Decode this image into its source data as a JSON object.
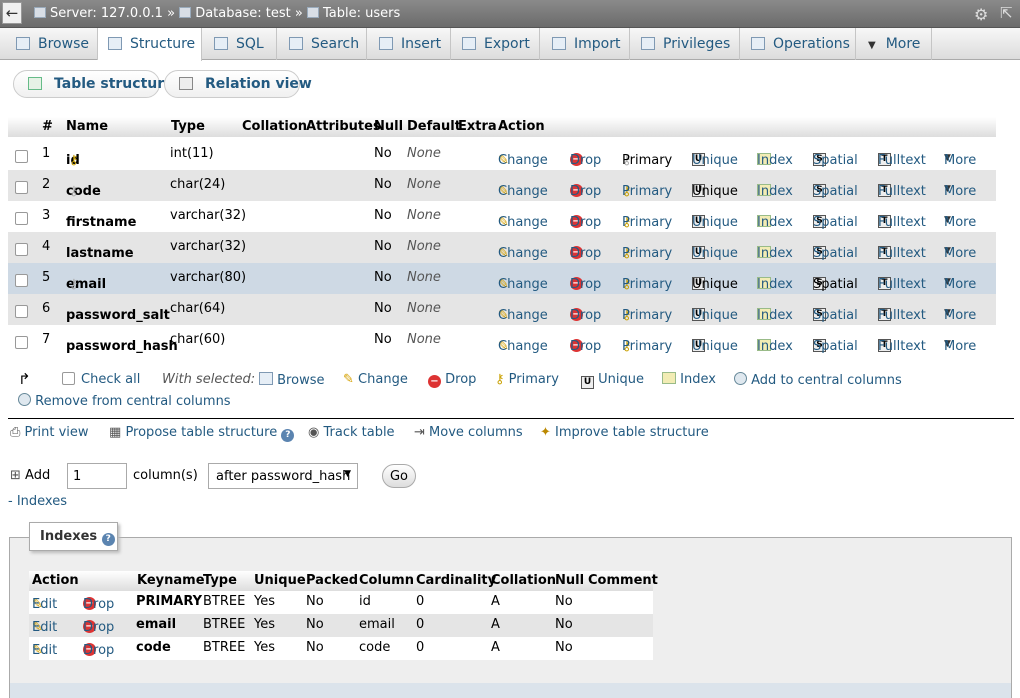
{
  "topbar": {
    "back": "←",
    "server": "Server: 127.0.0.1",
    "database": "Database: test",
    "table": "Table: users",
    "sep": "»"
  },
  "tabs": [
    {
      "label": "Browse",
      "icon": "browse-icon"
    },
    {
      "label": "Structure",
      "icon": "structure-icon",
      "active": true
    },
    {
      "label": "SQL",
      "icon": "sql-icon"
    },
    {
      "label": "Search",
      "icon": "search-icon"
    },
    {
      "label": "Insert",
      "icon": "insert-icon"
    },
    {
      "label": "Export",
      "icon": "export-icon"
    },
    {
      "label": "Import",
      "icon": "import-icon"
    },
    {
      "label": "Privileges",
      "icon": "privileges-icon"
    },
    {
      "label": "Operations",
      "icon": "wrench-icon"
    },
    {
      "label": "More",
      "icon": "chevron-down-icon"
    }
  ],
  "subtabs": {
    "table_structure": "Table structure",
    "relation_view": "Relation view"
  },
  "structure": {
    "headers": [
      "#",
      "Name",
      "Type",
      "Collation",
      "Attributes",
      "Null",
      "Default",
      "Extra",
      "Action"
    ],
    "rows": [
      {
        "num": "1",
        "name": "id",
        "type": "int(11)",
        "null": "No",
        "default": "None",
        "key": "primary"
      },
      {
        "num": "2",
        "name": "code",
        "type": "char(24)",
        "null": "No",
        "default": "None",
        "key": "unique"
      },
      {
        "num": "3",
        "name": "firstname",
        "type": "varchar(32)",
        "null": "No",
        "default": "None",
        "key": ""
      },
      {
        "num": "4",
        "name": "lastname",
        "type": "varchar(32)",
        "null": "No",
        "default": "None",
        "key": ""
      },
      {
        "num": "5",
        "name": "email",
        "type": "varchar(80)",
        "null": "No",
        "default": "None",
        "key": "unique"
      },
      {
        "num": "6",
        "name": "password_salt",
        "type": "char(64)",
        "null": "No",
        "default": "None",
        "key": ""
      },
      {
        "num": "7",
        "name": "password_hash",
        "type": "char(60)",
        "null": "No",
        "default": "None",
        "key": ""
      }
    ],
    "actions": {
      "change": "Change",
      "drop": "Drop",
      "primary": "Primary",
      "unique": "Unique",
      "index": "Index",
      "spatial": "Spatial",
      "fulltext": "Fulltext",
      "more": "More"
    }
  },
  "bulk": {
    "check_all": "Check all",
    "with_selected": "With selected:",
    "browse": "Browse",
    "change": "Change",
    "drop": "Drop",
    "primary": "Primary",
    "unique": "Unique",
    "index": "Index",
    "add_central": "Add to central columns",
    "remove_central": "Remove from central columns"
  },
  "tools": {
    "print_view": "Print view",
    "propose": "Propose table structure",
    "track": "Track table",
    "move": "Move columns",
    "improve": "Improve table structure"
  },
  "add_column": {
    "label": "Add",
    "count": "1",
    "suffix": "column(s)",
    "position": "after password_hash",
    "go": "Go"
  },
  "indexes_toggle": "- Indexes",
  "indexes": {
    "legend": "Indexes",
    "headers": [
      "Action",
      "Keyname",
      "Type",
      "Unique",
      "Packed",
      "Column",
      "Cardinality",
      "Collation",
      "Null",
      "Comment"
    ],
    "edit": "Edit",
    "drop": "Drop",
    "rows": [
      {
        "keyname": "PRIMARY",
        "type": "BTREE",
        "unique": "Yes",
        "packed": "No",
        "column": "id",
        "cardinality": "0",
        "collation": "A",
        "null": "No",
        "comment": ""
      },
      {
        "keyname": "email",
        "type": "BTREE",
        "unique": "Yes",
        "packed": "No",
        "column": "email",
        "cardinality": "0",
        "collation": "A",
        "null": "No",
        "comment": ""
      },
      {
        "keyname": "code",
        "type": "BTREE",
        "unique": "Yes",
        "packed": "No",
        "column": "code",
        "cardinality": "0",
        "collation": "A",
        "null": "No",
        "comment": ""
      }
    ]
  },
  "colors": {
    "link": "#235a81",
    "row_even": "#e5e5e5",
    "row_highlight": "#ced9e4"
  }
}
